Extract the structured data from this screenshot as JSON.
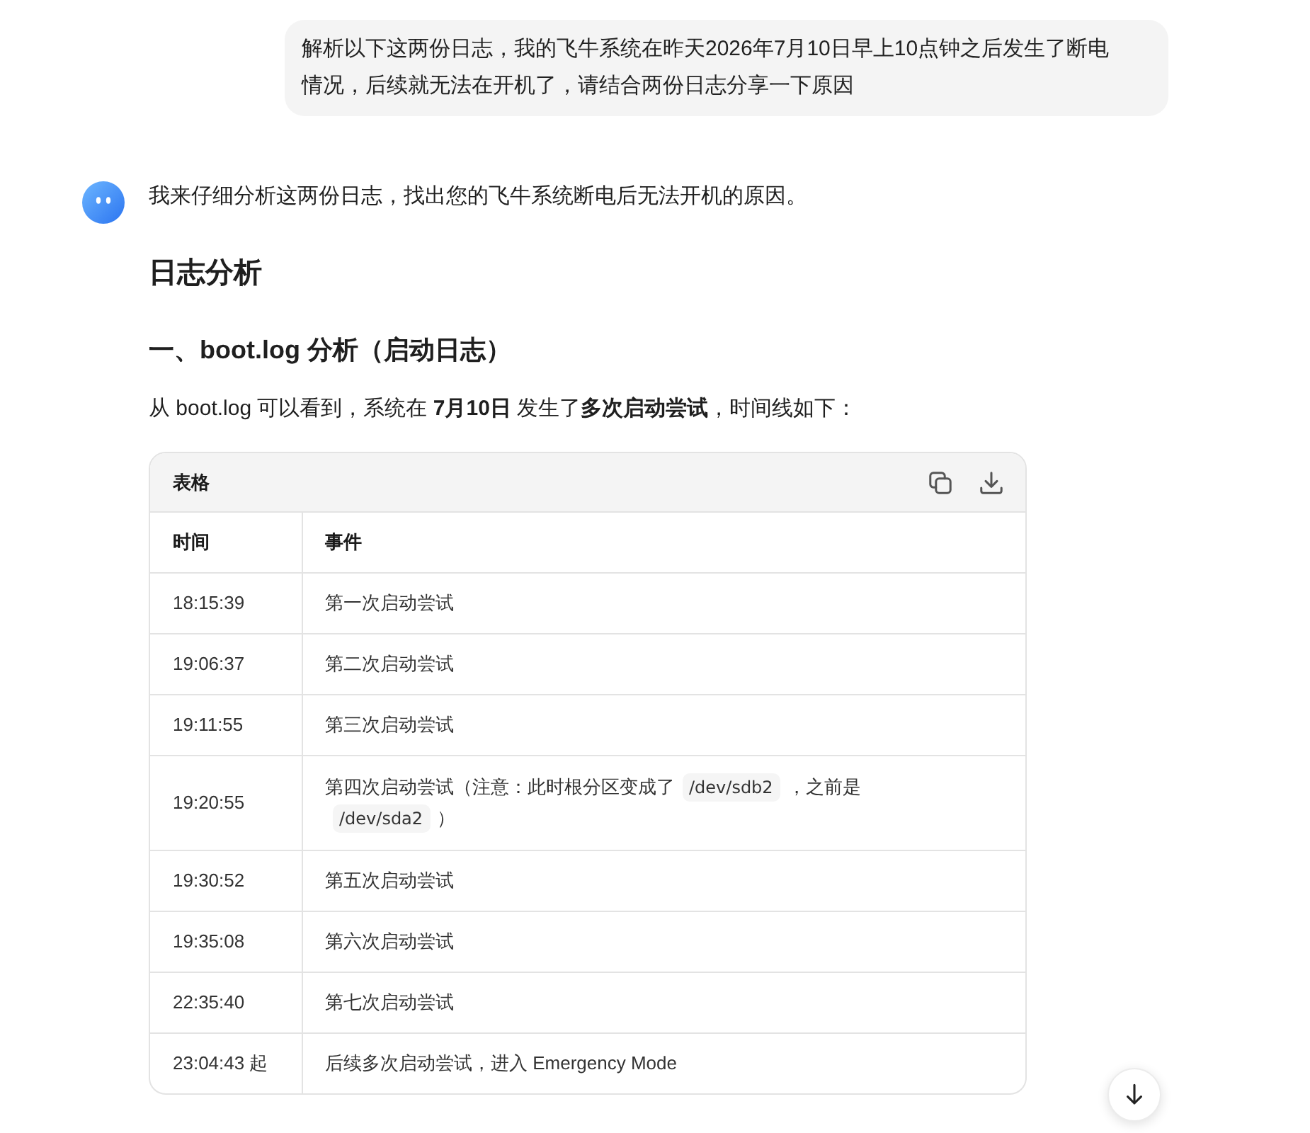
{
  "user_message": {
    "text": "解析以下这两份日志，我的飞牛系统在昨天2026年7月10日早上10点钟之后发生了断电情况，后续就无法在开机了，请结合两份日志分享一下原因"
  },
  "assistant": {
    "intro": "我来仔细分析这两份日志，找出您的飞牛系统断电后无法开机的原因。",
    "heading": "日志分析",
    "subheading": "一、boot.log 分析（启动日志）",
    "paragraph": "从 boot.log 可以看到，系统在 **7月10日** 发生了**多次启动尝试**，时间线如下："
  },
  "table": {
    "title": "表格",
    "columns": [
      "时间",
      "事件"
    ],
    "rows": [
      {
        "time": "18:15:39",
        "event": [
          {
            "kind": "text",
            "text": "第一次启动尝试"
          }
        ]
      },
      {
        "time": "19:06:37",
        "event": [
          {
            "kind": "text",
            "text": "第二次启动尝试"
          }
        ]
      },
      {
        "time": "19:11:55",
        "event": [
          {
            "kind": "text",
            "text": "第三次启动尝试"
          }
        ]
      },
      {
        "time": "19:20:55",
        "event": [
          {
            "kind": "text",
            "text": "第四次启动尝试（注意：此时根分区变成了"
          },
          {
            "kind": "code",
            "text": "/dev/sdb2"
          },
          {
            "kind": "text",
            "text": "，之前是"
          },
          {
            "kind": "code",
            "text": "/dev/sda2"
          },
          {
            "kind": "text",
            "text": "）"
          }
        ]
      },
      {
        "time": "19:30:52",
        "event": [
          {
            "kind": "text",
            "text": "第五次启动尝试"
          }
        ]
      },
      {
        "time": "19:35:08",
        "event": [
          {
            "kind": "text",
            "text": "第六次启动尝试"
          }
        ]
      },
      {
        "time": "22:35:40",
        "event": [
          {
            "kind": "text",
            "text": "第七次启动尝试"
          }
        ]
      },
      {
        "time": "23:04:43 起",
        "event": [
          {
            "kind": "text",
            "text": "后续多次启动尝试，进入 Emergency Mode"
          }
        ]
      }
    ]
  }
}
